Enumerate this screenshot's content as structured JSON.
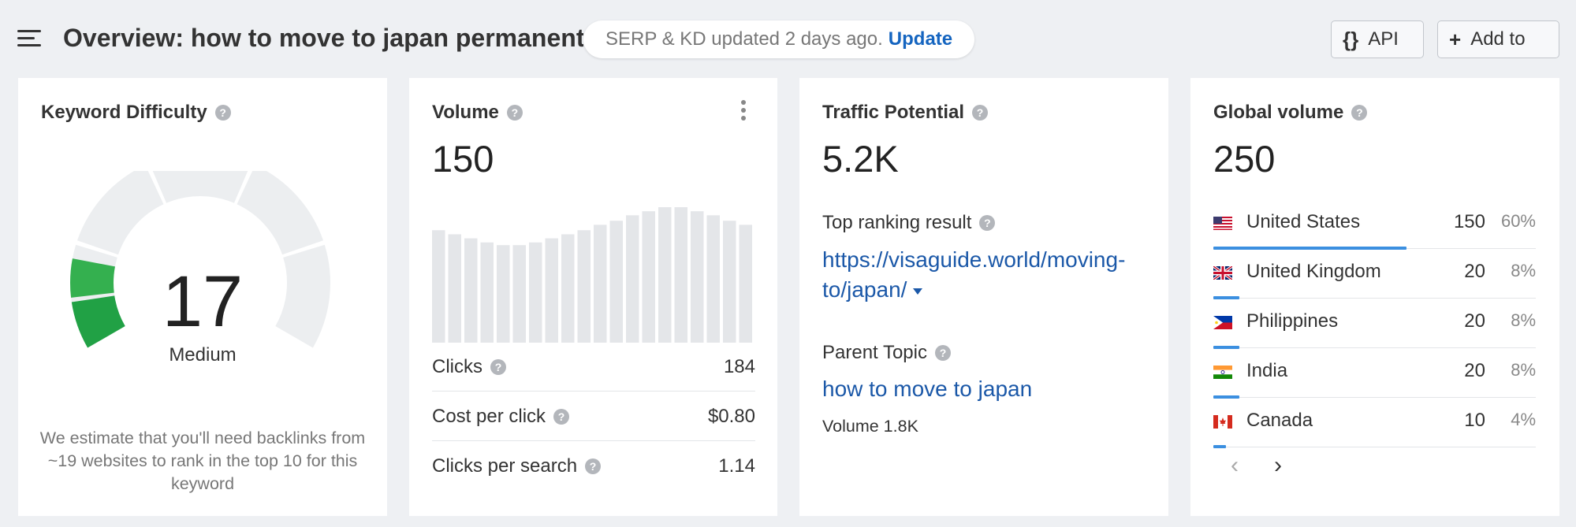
{
  "header": {
    "title": "Overview: how to move to japan permanently",
    "serp_notice": "SERP & KD updated 2 days ago.",
    "update_link": "Update",
    "api_icon": "{}",
    "api_label": "API",
    "add_icon": "+",
    "add_label": "Add to"
  },
  "keyword_difficulty": {
    "title": "Keyword Difficulty",
    "help": "?",
    "value": "17",
    "label": "Medium",
    "note": "We estimate that you'll need backlinks from ~19 websites to rank in the top 10 for this keyword",
    "gauge_level": 17,
    "colors": {
      "fill": "#2ea14a",
      "track": "#eceef0"
    }
  },
  "volume": {
    "title": "Volume",
    "help": "?",
    "value": "150",
    "trend": [
      0.83,
      0.8,
      0.77,
      0.74,
      0.72,
      0.72,
      0.74,
      0.77,
      0.8,
      0.83,
      0.87,
      0.9,
      0.94,
      0.97,
      1.0,
      1.0,
      0.97,
      0.94,
      0.9,
      0.87
    ],
    "metrics": [
      {
        "label": "Clicks",
        "value": "184"
      },
      {
        "label": "Cost per click",
        "value": "$0.80"
      },
      {
        "label": "Clicks per search",
        "value": "1.14"
      }
    ],
    "colors": {
      "bar": "#e4e6e9"
    }
  },
  "traffic_potential": {
    "title": "Traffic Potential",
    "help": "?",
    "value": "5.2K",
    "top_ranking_label": "Top ranking result",
    "top_url_line1": "https://visaguide.world/moving-",
    "top_url_line2": "to/japan/",
    "parent_topic_label": "Parent Topic",
    "parent_topic": "how to move to japan",
    "parent_volume": "Volume 1.8K"
  },
  "global_volume": {
    "title": "Global volume",
    "help": "?",
    "value": "250",
    "countries": [
      {
        "name": "United States",
        "volume": "150",
        "pct": "60%",
        "share": 0.6,
        "flag": "us-flag-icon"
      },
      {
        "name": "United Kingdom",
        "volume": "20",
        "pct": "8%",
        "share": 0.08,
        "flag": "uk-flag-icon"
      },
      {
        "name": "Philippines",
        "volume": "20",
        "pct": "8%",
        "share": 0.08,
        "flag": "ph-flag-icon"
      },
      {
        "name": "India",
        "volume": "20",
        "pct": "8%",
        "share": 0.08,
        "flag": "in-flag-icon"
      },
      {
        "name": "Canada",
        "volume": "10",
        "pct": "4%",
        "share": 0.04,
        "flag": "ca-flag-icon"
      }
    ],
    "pager_prev": "‹",
    "pager_next": "›",
    "colors": {
      "bar": "#3b8fe0"
    }
  }
}
